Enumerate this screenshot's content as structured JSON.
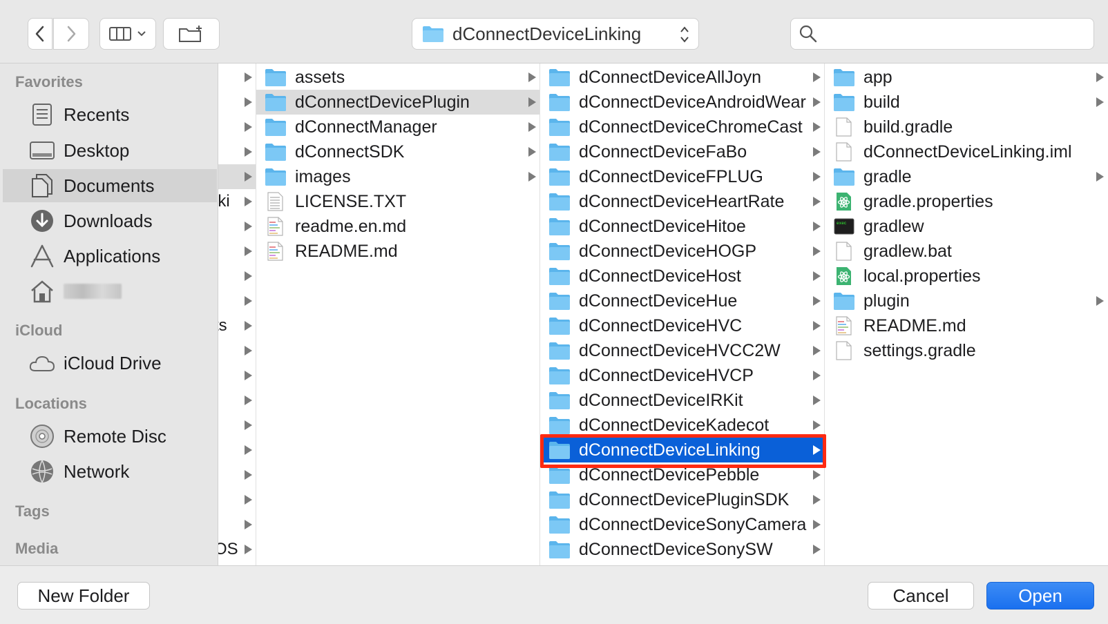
{
  "toolbar": {
    "path_label": "dConnectDeviceLinking",
    "search_placeholder": ""
  },
  "sidebar": {
    "headers": {
      "favorites": "Favorites",
      "icloud": "iCloud",
      "locations": "Locations",
      "tags": "Tags",
      "media": "Media"
    },
    "items": [
      {
        "label": "Recents",
        "icon": "recents-icon"
      },
      {
        "label": "Desktop",
        "icon": "desktop-icon"
      },
      {
        "label": "Documents",
        "icon": "documents-icon",
        "selected": true
      },
      {
        "label": "Downloads",
        "icon": "downloads-icon"
      },
      {
        "label": "Applications",
        "icon": "applications-icon"
      },
      {
        "label": "",
        "icon": "home-icon"
      },
      {
        "label": "iCloud Drive",
        "icon": "icloud-icon"
      },
      {
        "label": "Remote Disc",
        "icon": "disc-icon"
      },
      {
        "label": "Network",
        "icon": "network-icon"
      }
    ]
  },
  "column0": {
    "partial_labels": [
      "iki",
      "ts",
      "OS"
    ]
  },
  "column1": {
    "items": [
      {
        "name": "assets",
        "type": "folder"
      },
      {
        "name": "dConnectDevicePlugin",
        "type": "folder",
        "selected_parent": true
      },
      {
        "name": "dConnectManager",
        "type": "folder"
      },
      {
        "name": "dConnectSDK",
        "type": "folder"
      },
      {
        "name": "images",
        "type": "folder"
      },
      {
        "name": "LICENSE.TXT",
        "type": "text"
      },
      {
        "name": "readme.en.md",
        "type": "md"
      },
      {
        "name": "README.md",
        "type": "md"
      }
    ]
  },
  "column2": {
    "items": [
      {
        "name": "dConnectDeviceAllJoyn"
      },
      {
        "name": "dConnectDeviceAndroidWear"
      },
      {
        "name": "dConnectDeviceChromeCast"
      },
      {
        "name": "dConnectDeviceFaBo"
      },
      {
        "name": "dConnectDeviceFPLUG"
      },
      {
        "name": "dConnectDeviceHeartRate"
      },
      {
        "name": "dConnectDeviceHitoe"
      },
      {
        "name": "dConnectDeviceHOGP"
      },
      {
        "name": "dConnectDeviceHost"
      },
      {
        "name": "dConnectDeviceHue"
      },
      {
        "name": "dConnectDeviceHVC"
      },
      {
        "name": "dConnectDeviceHVCC2W"
      },
      {
        "name": "dConnectDeviceHVCP"
      },
      {
        "name": "dConnectDeviceIRKit"
      },
      {
        "name": "dConnectDeviceKadecot"
      },
      {
        "name": "dConnectDeviceLinking",
        "selected": true
      },
      {
        "name": "dConnectDevicePebble"
      },
      {
        "name": "dConnectDevicePluginSDK"
      },
      {
        "name": "dConnectDeviceSonyCamera"
      },
      {
        "name": "dConnectDeviceSonySW"
      }
    ]
  },
  "column3": {
    "items": [
      {
        "name": "app",
        "type": "folder"
      },
      {
        "name": "build",
        "type": "folder"
      },
      {
        "name": "build.gradle",
        "type": "doc"
      },
      {
        "name": "dConnectDeviceLinking.iml",
        "type": "doc"
      },
      {
        "name": "gradle",
        "type": "folder"
      },
      {
        "name": "gradle.properties",
        "type": "atom"
      },
      {
        "name": "gradlew",
        "type": "terminal"
      },
      {
        "name": "gradlew.bat",
        "type": "doc"
      },
      {
        "name": "local.properties",
        "type": "atom"
      },
      {
        "name": "plugin",
        "type": "folder"
      },
      {
        "name": "README.md",
        "type": "md"
      },
      {
        "name": "settings.gradle",
        "type": "doc"
      }
    ]
  },
  "footer": {
    "new_folder": "New Folder",
    "cancel": "Cancel",
    "open": "Open"
  },
  "colors": {
    "selection": "#0a60d8",
    "highlight_box": "#ff2a12",
    "folder": "#6cc1f4"
  }
}
